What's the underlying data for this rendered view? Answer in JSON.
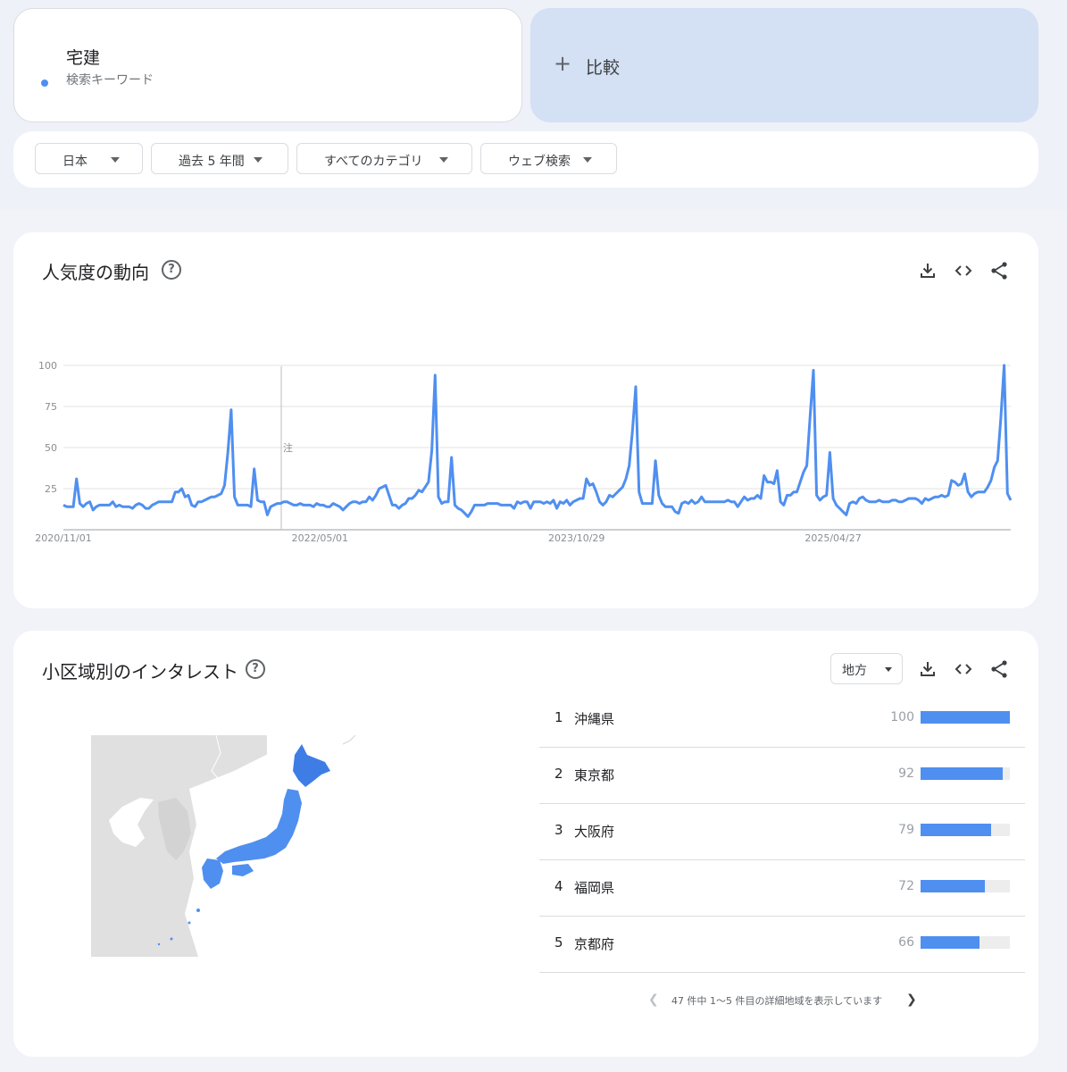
{
  "search": {
    "term": "宅建",
    "term_type": "検索キーワード",
    "term_color": "#4f8ff0",
    "compare_label": "比較",
    "compare_icon": "plus-icon"
  },
  "filters": [
    {
      "label": "日本"
    },
    {
      "label": "過去 5 年間"
    },
    {
      "label": "すべてのカテゴリ"
    },
    {
      "label": "ウェブ検索"
    }
  ],
  "trend": {
    "title": "人気度の動向",
    "help_icon": "help-circle-icon",
    "help_glyph": "?",
    "tools": [
      "download-icon",
      "embed-code-icon",
      "share-icon"
    ],
    "note_marker": "注"
  },
  "chart_data": {
    "type": "line",
    "title": "",
    "xlabel": "",
    "ylabel": "",
    "ylim": [
      0,
      100
    ],
    "yticks": [
      25,
      50,
      75,
      100
    ],
    "xtick_labels": [
      "2020/11/01",
      "2022/05/01",
      "2023/10/29",
      "2025/04/27"
    ],
    "series_color": "#4f8ff0",
    "grid": true,
    "series": [
      {
        "values": [
          15,
          14,
          14,
          14,
          31,
          16,
          14,
          16,
          17,
          12,
          14,
          15,
          15,
          15,
          15,
          17,
          14,
          15,
          14,
          14,
          14,
          13,
          15,
          16,
          15,
          13,
          13,
          15,
          16,
          17,
          17,
          17,
          17,
          17,
          23,
          23,
          25,
          20,
          21,
          15,
          14,
          17,
          17,
          18,
          19,
          20,
          20,
          21,
          22,
          27,
          47,
          73,
          20,
          15,
          15,
          15,
          15,
          14,
          37,
          18,
          17,
          17,
          9,
          14,
          15,
          16,
          16,
          17,
          17,
          16,
          15,
          15,
          16,
          15,
          15,
          15,
          14,
          16,
          15,
          15,
          14,
          14,
          16,
          15,
          14,
          12,
          14,
          16,
          17,
          17,
          16,
          17,
          17,
          20,
          18,
          21,
          25,
          26,
          27,
          21,
          15,
          15,
          13,
          15,
          16,
          19,
          19,
          21,
          24,
          23,
          26,
          29,
          48,
          94,
          20,
          16,
          17,
          17,
          44,
          15,
          13,
          12,
          10,
          8,
          11,
          15,
          15,
          15,
          15,
          16,
          16,
          16,
          16,
          15,
          15,
          15,
          15,
          13,
          17,
          16,
          17,
          17,
          13,
          17,
          17,
          17,
          16,
          17,
          16,
          18,
          13,
          17,
          16,
          18,
          15,
          17,
          18,
          19,
          19,
          31,
          27,
          28,
          23,
          17,
          15,
          17,
          21,
          20,
          22,
          24,
          26,
          31,
          39,
          60,
          87,
          23,
          16,
          16,
          16,
          16,
          42,
          21,
          16,
          14,
          14,
          14,
          11,
          10,
          16,
          17,
          16,
          18,
          16,
          17,
          20,
          17,
          17,
          17,
          17,
          17,
          17,
          17,
          18,
          17,
          17,
          14,
          17,
          20,
          18,
          19,
          19,
          21,
          19,
          33,
          29,
          29,
          28,
          36,
          17,
          15,
          21,
          21,
          23,
          23,
          29,
          35,
          39,
          69,
          97,
          21,
          18,
          20,
          21,
          47,
          19,
          15,
          13,
          11,
          9,
          16,
          17,
          16,
          19,
          20,
          18,
          17,
          17,
          17,
          18,
          17,
          17,
          17,
          18,
          18,
          17,
          17,
          18,
          19,
          19,
          19,
          18,
          16,
          19,
          18,
          19,
          20,
          20,
          21,
          20,
          21,
          30,
          29,
          27,
          28,
          34,
          23,
          20,
          22,
          23,
          23,
          23,
          26,
          30,
          38,
          42,
          68,
          100,
          22,
          18
        ]
      }
    ]
  },
  "region": {
    "title": "小区域別のインタレスト",
    "help_glyph": "?",
    "select_label": "地方",
    "tools": [
      "download-icon",
      "embed-code-icon",
      "share-icon"
    ],
    "rows": [
      {
        "rank": "1",
        "name": "沖縄県",
        "value": "100",
        "fraction": 1.0
      },
      {
        "rank": "2",
        "name": "東京都",
        "value": "92",
        "fraction": 0.92
      },
      {
        "rank": "3",
        "name": "大阪府",
        "value": "79",
        "fraction": 0.79
      },
      {
        "rank": "4",
        "name": "福岡県",
        "value": "72",
        "fraction": 0.72
      },
      {
        "rank": "5",
        "name": "京都府",
        "value": "66",
        "fraction": 0.66
      }
    ],
    "pager_text": "47 件中 1〜5 件目の詳細地域を表示しています",
    "map_colors": {
      "land": "#e0e0e0",
      "highlight": "#4f8ff0",
      "hokkaido": "#3f7de6"
    }
  }
}
